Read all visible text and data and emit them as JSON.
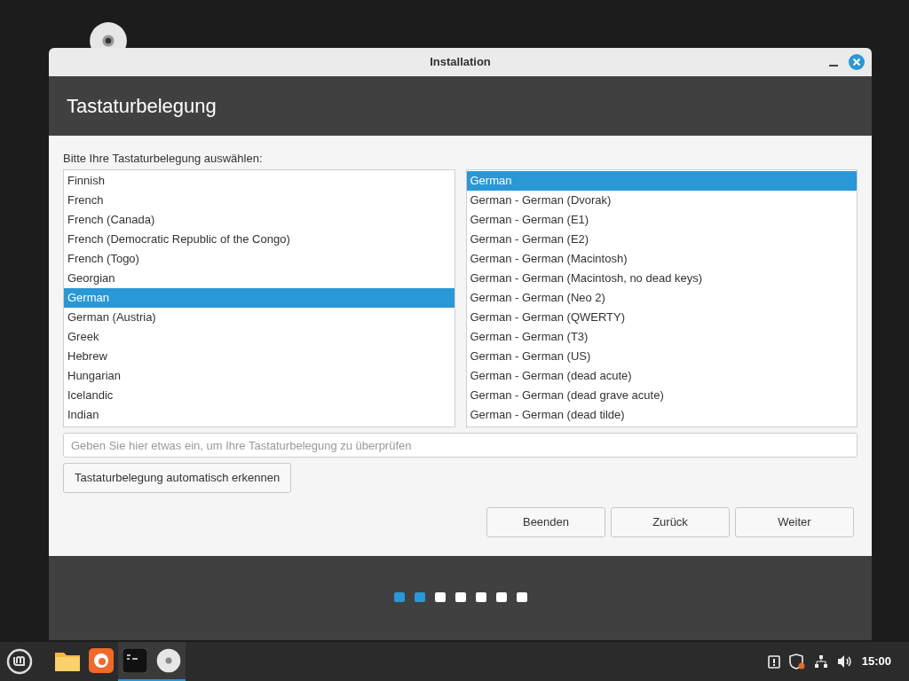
{
  "window": {
    "title": "Installation"
  },
  "header": {
    "title": "Tastaturbelegung"
  },
  "prompt": "Bitte Ihre Tastaturbelegung auswählen:",
  "layouts": [
    {
      "label": "Finnish",
      "selected": false
    },
    {
      "label": "French",
      "selected": false
    },
    {
      "label": "French (Canada)",
      "selected": false
    },
    {
      "label": "French (Democratic Republic of the Congo)",
      "selected": false
    },
    {
      "label": "French (Togo)",
      "selected": false
    },
    {
      "label": "Georgian",
      "selected": false
    },
    {
      "label": "German",
      "selected": true
    },
    {
      "label": "German (Austria)",
      "selected": false
    },
    {
      "label": "Greek",
      "selected": false
    },
    {
      "label": "Hebrew",
      "selected": false
    },
    {
      "label": "Hungarian",
      "selected": false
    },
    {
      "label": "Icelandic",
      "selected": false
    },
    {
      "label": "Indian",
      "selected": false
    }
  ],
  "variants": [
    {
      "label": "German",
      "selected": true
    },
    {
      "label": "German - German (Dvorak)",
      "selected": false
    },
    {
      "label": "German - German (E1)",
      "selected": false
    },
    {
      "label": "German - German (E2)",
      "selected": false
    },
    {
      "label": "German - German (Macintosh)",
      "selected": false
    },
    {
      "label": "German - German (Macintosh, no dead keys)",
      "selected": false
    },
    {
      "label": "German - German (Neo 2)",
      "selected": false
    },
    {
      "label": "German - German (QWERTY)",
      "selected": false
    },
    {
      "label": "German - German (T3)",
      "selected": false
    },
    {
      "label": "German - German (US)",
      "selected": false
    },
    {
      "label": "German - German (dead acute)",
      "selected": false
    },
    {
      "label": "German - German (dead grave acute)",
      "selected": false
    },
    {
      "label": "German - German (dead tilde)",
      "selected": false
    }
  ],
  "test_field": {
    "placeholder": "Geben Sie hier etwas ein, um Ihre Tastaturbelegung zu überprüfen"
  },
  "detect_button": "Tastaturbelegung automatisch erkennen",
  "buttons": [
    "Beenden",
    "Zurück",
    "Weiter"
  ],
  "steps": [
    {
      "selected": true
    },
    {
      "selected": true
    },
    {
      "selected": false
    },
    {
      "selected": false
    },
    {
      "selected": false
    },
    {
      "selected": false
    },
    {
      "selected": false
    }
  ],
  "taskbar": {
    "apps": [
      {
        "kind": "folder",
        "active": false
      },
      {
        "kind": "firefox",
        "active": false
      },
      {
        "kind": "terminal",
        "active": true
      },
      {
        "kind": "disc",
        "active": true
      }
    ],
    "clock": "15:00"
  }
}
